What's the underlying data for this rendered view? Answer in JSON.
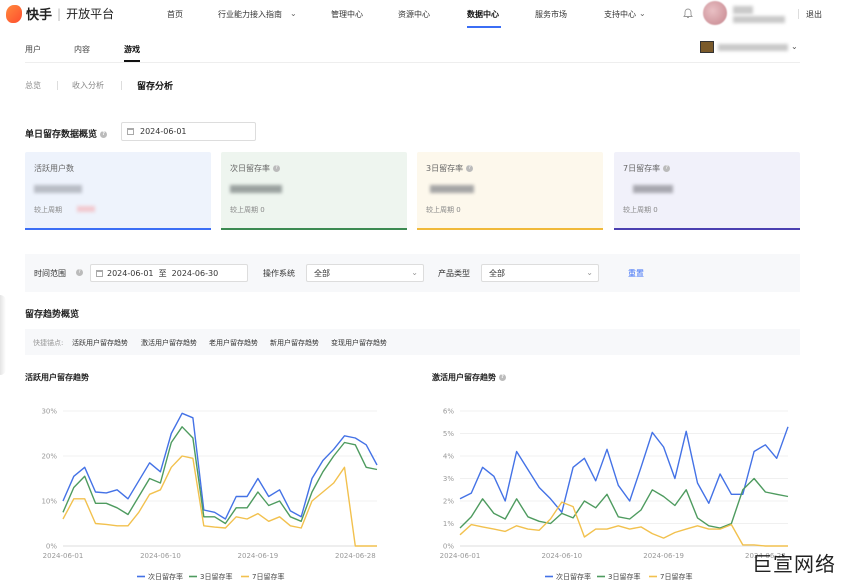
{
  "nav": {
    "brand": "快手",
    "platform": "开放平台",
    "items": [
      "首页",
      "行业能力接入指南",
      "管理中心",
      "资源中心",
      "数据中心",
      "服务市场",
      "支持中心"
    ],
    "logout": "退出"
  },
  "subtabs": [
    "用户",
    "内容",
    "游戏"
  ],
  "tabs2": [
    "总览",
    "收入分析",
    "留存分析"
  ],
  "single_day": {
    "title": "单日留存数据概览",
    "date": "2024-06-01"
  },
  "cards": [
    {
      "title": "活跃用户数",
      "foot": "较上周期",
      "bg": "#eef3fc",
      "bar": "#3b6ef5"
    },
    {
      "title": "次日留存率",
      "foot": "较上周期 0",
      "bg": "#eef5ef",
      "bar": "#3c8a52"
    },
    {
      "title": "3日留存率",
      "foot": "较上周期 0",
      "bg": "#fdf8ec",
      "bar": "#f0b93a"
    },
    {
      "title": "7日留存率",
      "foot": "较上周期 0",
      "bg": "#f1f1fa",
      "bar": "#4a3fb0"
    }
  ],
  "filter": {
    "time_label": "时间范围",
    "time_value": "2024-06-01  至  2024-06-30",
    "os_label": "操作系统",
    "os_value": "全部",
    "product_label": "产品类型",
    "product_value": "全部",
    "reset": "重置"
  },
  "trend": {
    "title": "留存趋势概览",
    "quick_label": "快捷锚点:",
    "quick_links": [
      "活跃用户留存趋势",
      "激活用户留存趋势",
      "老用户留存趋势",
      "新用户留存趋势",
      "变现用户留存趋势"
    ]
  },
  "colors": {
    "blue": "#4472e6",
    "green": "#4e9b5f",
    "yellow": "#f2c14e"
  },
  "chart_data": [
    {
      "type": "line",
      "title": "活跃用户留存趋势",
      "x": [
        "2024-06-01",
        "2024-06-02",
        "2024-06-03",
        "2024-06-04",
        "2024-06-05",
        "2024-06-06",
        "2024-06-07",
        "2024-06-08",
        "2024-06-09",
        "2024-06-10",
        "2024-06-11",
        "2024-06-12",
        "2024-06-13",
        "2024-06-14",
        "2024-06-15",
        "2024-06-16",
        "2024-06-17",
        "2024-06-18",
        "2024-06-19",
        "2024-06-20",
        "2024-06-21",
        "2024-06-22",
        "2024-06-23",
        "2024-06-24",
        "2024-06-25",
        "2024-06-26",
        "2024-06-27",
        "2024-06-28",
        "2024-06-29",
        "2024-06-30"
      ],
      "x_ticks": [
        "2024-06-01",
        "2024-06-10",
        "2024-06-19",
        "2024-06-28"
      ],
      "y_ticks": [
        "0%",
        "10%",
        "20%",
        "30%"
      ],
      "ylim": [
        0,
        30
      ],
      "series": [
        {
          "name": "次日留存率",
          "color": "#4472e6",
          "values": [
            10,
            15.5,
            17.5,
            12,
            11.8,
            12.5,
            10.5,
            14.5,
            18.5,
            16.5,
            25,
            29.5,
            28.5,
            8,
            7.5,
            6,
            11,
            11,
            15,
            11,
            12.5,
            7.8,
            6.5,
            15,
            19,
            21.5,
            24.5,
            24,
            22.5,
            18
          ]
        },
        {
          "name": "3日留存率",
          "color": "#4e9b5f",
          "values": [
            7.5,
            13,
            15.5,
            9.5,
            9.5,
            8.5,
            7,
            11,
            15,
            14,
            23,
            26.5,
            24,
            6.5,
            6.5,
            5,
            8.5,
            8.5,
            12,
            9,
            10,
            6.5,
            5.5,
            12,
            16.5,
            20,
            23,
            22.5,
            17.5,
            17
          ]
        },
        {
          "name": "7日留存率",
          "color": "#f2c14e",
          "values": [
            6,
            10.5,
            10.5,
            5,
            4.8,
            4.5,
            4.5,
            7.5,
            11.5,
            12.5,
            17.5,
            20,
            19.5,
            4.5,
            4.2,
            4,
            6.5,
            6,
            7.2,
            5.5,
            6.5,
            4.5,
            4,
            10,
            12,
            14,
            17.5,
            0,
            0,
            0
          ]
        }
      ],
      "legend": "bottom"
    },
    {
      "type": "line",
      "title": "激活用户留存趋势",
      "x": [
        "2024-06-01",
        "2024-06-02",
        "2024-06-03",
        "2024-06-04",
        "2024-06-05",
        "2024-06-06",
        "2024-06-07",
        "2024-06-08",
        "2024-06-09",
        "2024-06-10",
        "2024-06-11",
        "2024-06-12",
        "2024-06-13",
        "2024-06-14",
        "2024-06-15",
        "2024-06-16",
        "2024-06-17",
        "2024-06-18",
        "2024-06-19",
        "2024-06-20",
        "2024-06-21",
        "2024-06-22",
        "2024-06-23",
        "2024-06-24",
        "2024-06-25",
        "2024-06-26",
        "2024-06-27",
        "2024-06-28",
        "2024-06-29",
        "2024-06-30"
      ],
      "x_ticks": [
        "2024-06-01",
        "2024-06-10",
        "2024-06-19",
        "2024-06-28"
      ],
      "y_ticks": [
        "0%",
        "1%",
        "2%",
        "3%",
        "4%",
        "5%",
        "6%"
      ],
      "ylim": [
        0,
        6
      ],
      "series": [
        {
          "name": "次日留存率",
          "color": "#4472e6",
          "values": [
            2.1,
            2.35,
            3.5,
            3.1,
            2,
            4.2,
            3.4,
            2.6,
            2.1,
            1.5,
            3.5,
            3.9,
            2.9,
            4.3,
            2.7,
            2,
            3.5,
            5.05,
            4.4,
            3,
            5.1,
            2.8,
            1.9,
            3.2,
            2.3,
            2.3,
            4.2,
            4.5,
            3.9,
            5.3
          ]
        },
        {
          "name": "3日留存率",
          "color": "#4e9b5f",
          "values": [
            0.8,
            1.3,
            2.1,
            1.45,
            1.2,
            2.1,
            1.3,
            1.1,
            1,
            1.45,
            1.25,
            2,
            1.7,
            2.3,
            1.3,
            1.2,
            1.6,
            2.5,
            2.2,
            1.8,
            2.5,
            1.25,
            0.9,
            0.8,
            1,
            2.5,
            3,
            2.4,
            2.3,
            2.2
          ]
        },
        {
          "name": "7日留存率",
          "color": "#f2c14e",
          "values": [
            0.5,
            0.95,
            0.85,
            0.75,
            0.65,
            0.9,
            0.75,
            0.7,
            1.2,
            1.95,
            1.75,
            0.4,
            0.75,
            0.75,
            0.9,
            0.75,
            0.85,
            0.55,
            0.35,
            0.6,
            0.75,
            0.9,
            0.75,
            0.75,
            0.95,
            0.05,
            0.05,
            0,
            0,
            0
          ]
        }
      ],
      "legend": "bottom"
    }
  ],
  "watermark": "巨宣网络"
}
